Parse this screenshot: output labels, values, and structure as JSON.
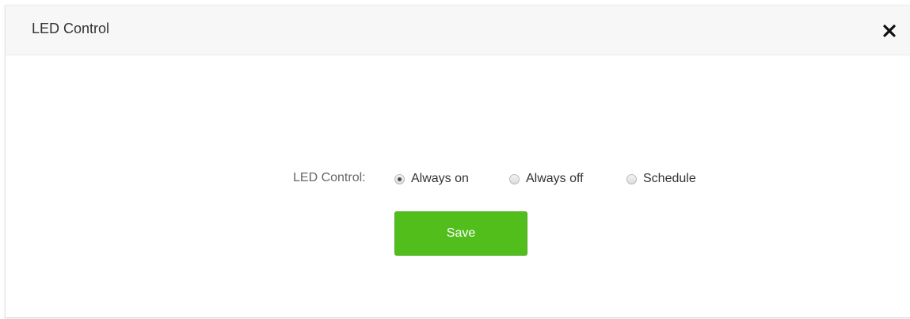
{
  "dialog": {
    "title": "LED Control",
    "close_icon": "close-icon"
  },
  "form": {
    "label": "LED Control:",
    "options": [
      {
        "label": "Always on",
        "checked": true
      },
      {
        "label": "Always off",
        "checked": false
      },
      {
        "label": "Schedule",
        "checked": false
      }
    ],
    "save_label": "Save"
  },
  "colors": {
    "header_bg": "#f7f7f7",
    "save_button": "#52be1c",
    "title_text": "#333333",
    "label_text": "#666666"
  }
}
